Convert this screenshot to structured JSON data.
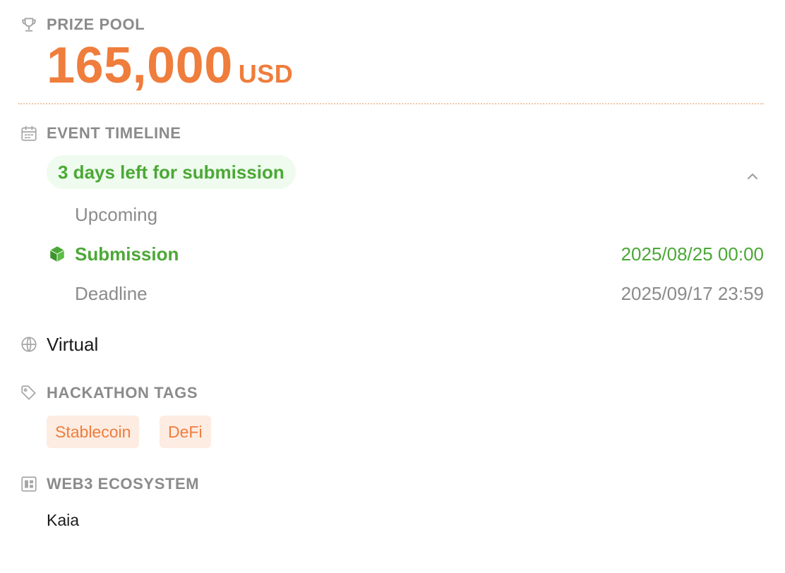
{
  "prize_pool": {
    "title": "PRIZE POOL",
    "amount": "165,000",
    "currency": "USD"
  },
  "event_timeline": {
    "title": "EVENT TIMELINE",
    "status_pill": "3 days left for submission",
    "items": [
      {
        "label": "Upcoming",
        "date": ""
      },
      {
        "label": "Submission",
        "date": "2025/08/25 00:00"
      },
      {
        "label": "Deadline",
        "date": "2025/09/17 23:59"
      }
    ]
  },
  "location": {
    "label": "Virtual"
  },
  "hackathon_tags": {
    "title": "HACKATHON TAGS",
    "tags": [
      "Stablecoin",
      "DeFi"
    ]
  },
  "web3_ecosystem": {
    "title": "WEB3 ECOSYSTEM",
    "value": "Kaia"
  },
  "colors": {
    "accent_orange": "#ef7d3c",
    "accent_green": "#4ba836",
    "tag_bg": "#fdece2",
    "pill_bg": "#eefbee"
  },
  "icons": {
    "prize": "trophy-icon",
    "timeline": "calendar-icon",
    "submission": "cube-icon",
    "location": "globe-icon",
    "tags": "tag-icon",
    "ecosystem": "grid-icon",
    "collapse": "chevron-up-icon"
  }
}
